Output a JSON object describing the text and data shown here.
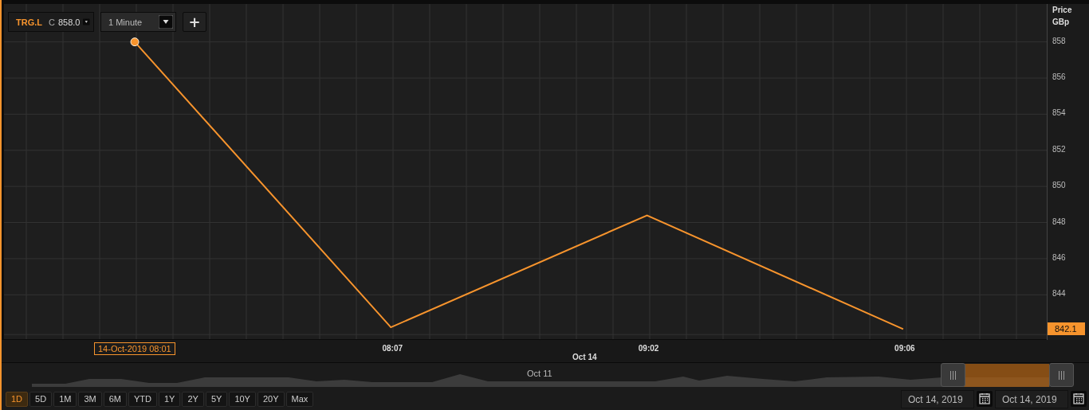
{
  "symbol_selector": {
    "close_label": "C",
    "close_value": "858.0"
  },
  "interval_dropdown": {
    "value": "1 Minute"
  },
  "add_button": {
    "label": "+"
  },
  "chart": {
    "axis_title": "Price",
    "axis_unit": "GBp",
    "last_price": "842.1",
    "crosshair_label": "14-Oct-2019 08:01",
    "day_label": "Oct 14",
    "chart_data": {
      "type": "line",
      "categories": [
        "08:07",
        "09:02",
        "09:06"
      ],
      "series": [
        {
          "name": "TRG.L",
          "color": "#f7942d",
          "values": [
            842.2,
            848.4,
            842.1
          ]
        }
      ],
      "grid": true,
      "ylim": [
        841.5,
        860.1
      ],
      "yticks": [
        844,
        846,
        848,
        850,
        852,
        854,
        856,
        858
      ]
    }
  },
  "navigator": {
    "label": "Oct 11"
  },
  "range_buttons": [
    {
      "label": "1D",
      "selected": true
    },
    {
      "label": "5D",
      "selected": false
    },
    {
      "label": "1M",
      "selected": false
    },
    {
      "label": "3M",
      "selected": false
    },
    {
      "label": "6M",
      "selected": false
    },
    {
      "label": "YTD",
      "selected": false
    },
    {
      "label": "1Y",
      "selected": false
    },
    {
      "label": "2Y",
      "selected": false
    },
    {
      "label": "5Y",
      "selected": false
    },
    {
      "label": "10Y",
      "selected": false
    },
    {
      "label": "20Y",
      "selected": false
    },
    {
      "label": "Max",
      "selected": false
    }
  ],
  "date_range": {
    "from": "Oct 14, 2019",
    "to": "Oct 14, 2019"
  }
}
